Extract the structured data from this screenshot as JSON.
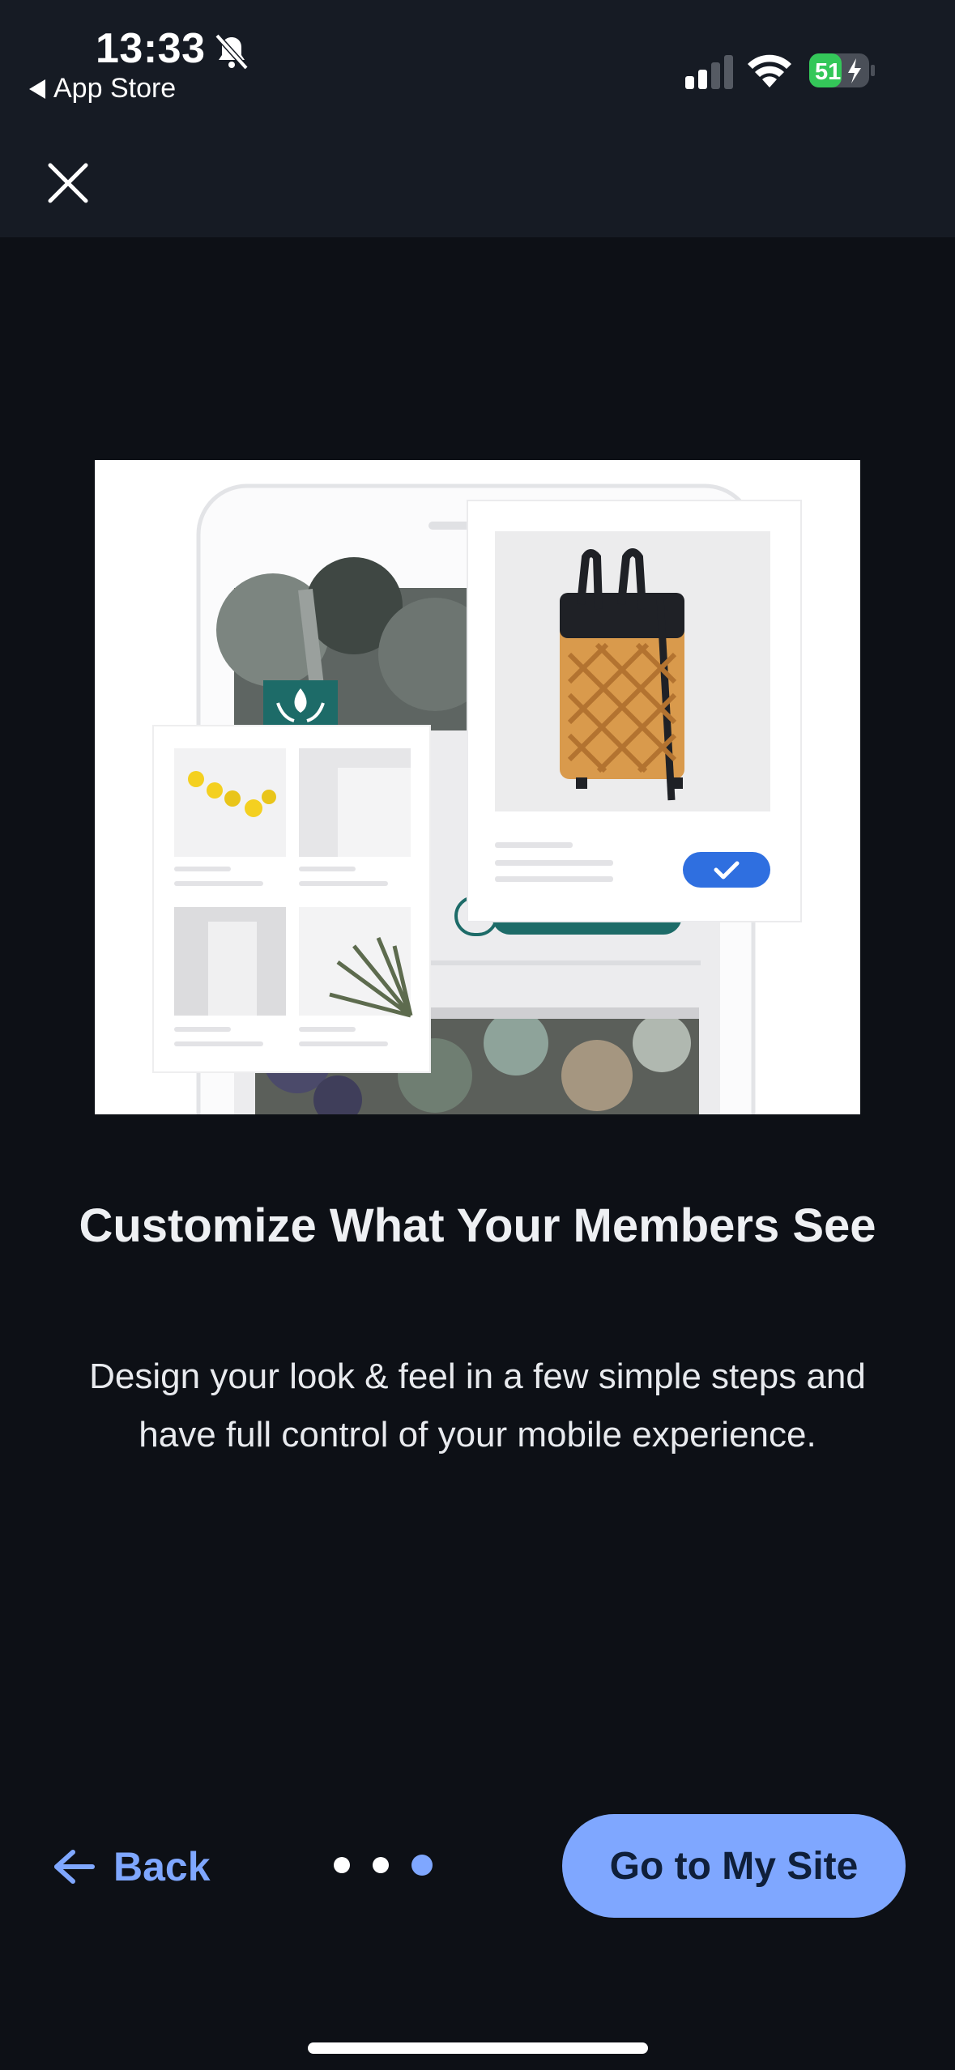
{
  "status_bar": {
    "time": "13:33",
    "back_app_label": "App Store",
    "battery_level": "51",
    "icons": [
      "bell-slash-icon",
      "signal-icon",
      "wifi-icon",
      "battery-icon"
    ]
  },
  "onboarding": {
    "title": "Customize What Your Members See",
    "description": "Design your look & feel in a few simple steps and have full control of your mobile experience.",
    "page_count": 3,
    "current_page": 3
  },
  "footer": {
    "back_label": "Back",
    "cta_label": "Go to My Site"
  },
  "colors": {
    "background": "#0d1016",
    "top_bar": "#161b24",
    "accent": "#7fa7ff",
    "teal": "#1d6b68",
    "check_blue": "#2f6fe0"
  }
}
